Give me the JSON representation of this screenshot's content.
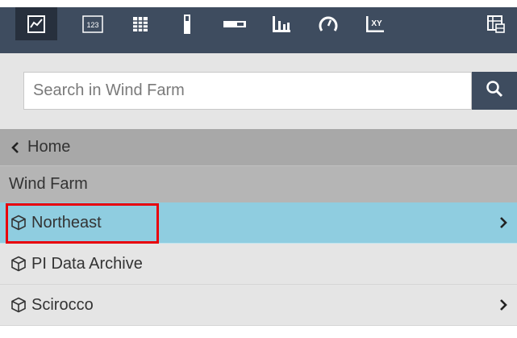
{
  "toolbar": {
    "buttons": [
      {
        "icon": "trend-icon",
        "active": true
      },
      {
        "icon": "value-icon",
        "label": "123"
      },
      {
        "icon": "table-icon"
      },
      {
        "icon": "vertical-gauge-icon"
      },
      {
        "icon": "horizontal-gauge-icon"
      },
      {
        "icon": "bar-chart-icon"
      },
      {
        "icon": "radial-gauge-icon"
      },
      {
        "icon": "xy-plot-icon",
        "label": "XY"
      },
      {
        "icon": "asset-comparison-table-icon"
      }
    ]
  },
  "search": {
    "placeholder": "Search in Wind Farm",
    "value": ""
  },
  "nav": {
    "home_label": "Home",
    "section_label": "Wind Farm",
    "items": [
      {
        "label": "Northeast",
        "has_children": true,
        "selected": true
      },
      {
        "label": "PI Data Archive",
        "has_children": false,
        "selected": false
      },
      {
        "label": "Scirocco",
        "has_children": true,
        "selected": false
      }
    ]
  },
  "colors": {
    "toolbar_bg": "#3e4c5f",
    "toolbar_active_bg": "#27303d",
    "selected_row": "#8fcde0",
    "highlight_border": "#e8000b"
  }
}
